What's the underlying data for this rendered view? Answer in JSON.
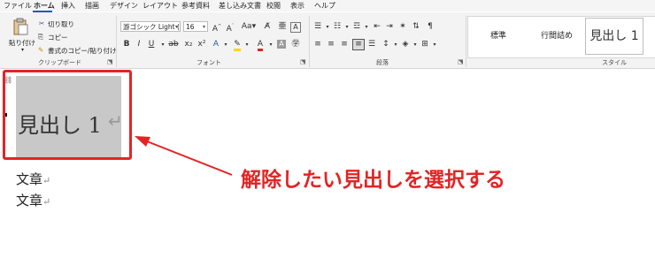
{
  "menu": {
    "tabs": [
      "ファイル",
      "ホーム",
      "挿入",
      "描画",
      "デザイン",
      "レイアウト",
      "参考資料",
      "差し込み文書",
      "校閲",
      "表示",
      "ヘルプ"
    ]
  },
  "clipboard": {
    "paste_label": "貼り付け",
    "cut_label": "切り取り",
    "copy_label": "コピー",
    "format_painter_label": "書式のコピー/貼り付け",
    "group_label": "クリップボード"
  },
  "font": {
    "font_name": "游ゴシック Light (見出",
    "font_size": "16",
    "group_label": "フォント"
  },
  "paragraph": {
    "group_label": "段落"
  },
  "styles": {
    "items": [
      "標準",
      "行間詰め",
      "見出し 1"
    ],
    "group_label": "スタイル"
  },
  "document": {
    "heading": "見出し 1",
    "paragraph_mark": "↵",
    "lines": [
      "文章",
      "文章"
    ]
  },
  "annotation": {
    "callout": "解除したい見出しを選択する",
    "color": "#e32424"
  }
}
